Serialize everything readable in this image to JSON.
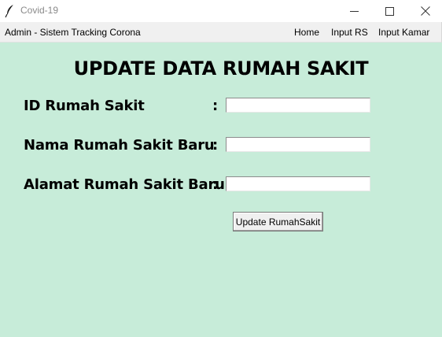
{
  "window": {
    "title": "Covid-19",
    "background": "#c7ecd9"
  },
  "menubar": {
    "app_title": "Admin - Sistem Tracking Corona",
    "items": [
      {
        "label": "Home"
      },
      {
        "label": "Input RS"
      },
      {
        "label": "Input Kamar"
      }
    ]
  },
  "form": {
    "heading": "UPDATE DATA RUMAH SAKIT",
    "fields": [
      {
        "label": "ID Rumah Sakit",
        "colon": ":",
        "value": ""
      },
      {
        "label": "Nama Rumah Sakit Baru",
        "colon": ":",
        "value": ""
      },
      {
        "label": "Alamat Rumah Sakit Baru",
        "colon": ":",
        "value": ""
      }
    ],
    "submit_label": "Update RumahSakit"
  },
  "icons": {
    "app": "feather-icon",
    "minimize": "minimize-icon",
    "maximize": "maximize-icon",
    "close": "close-icon"
  }
}
